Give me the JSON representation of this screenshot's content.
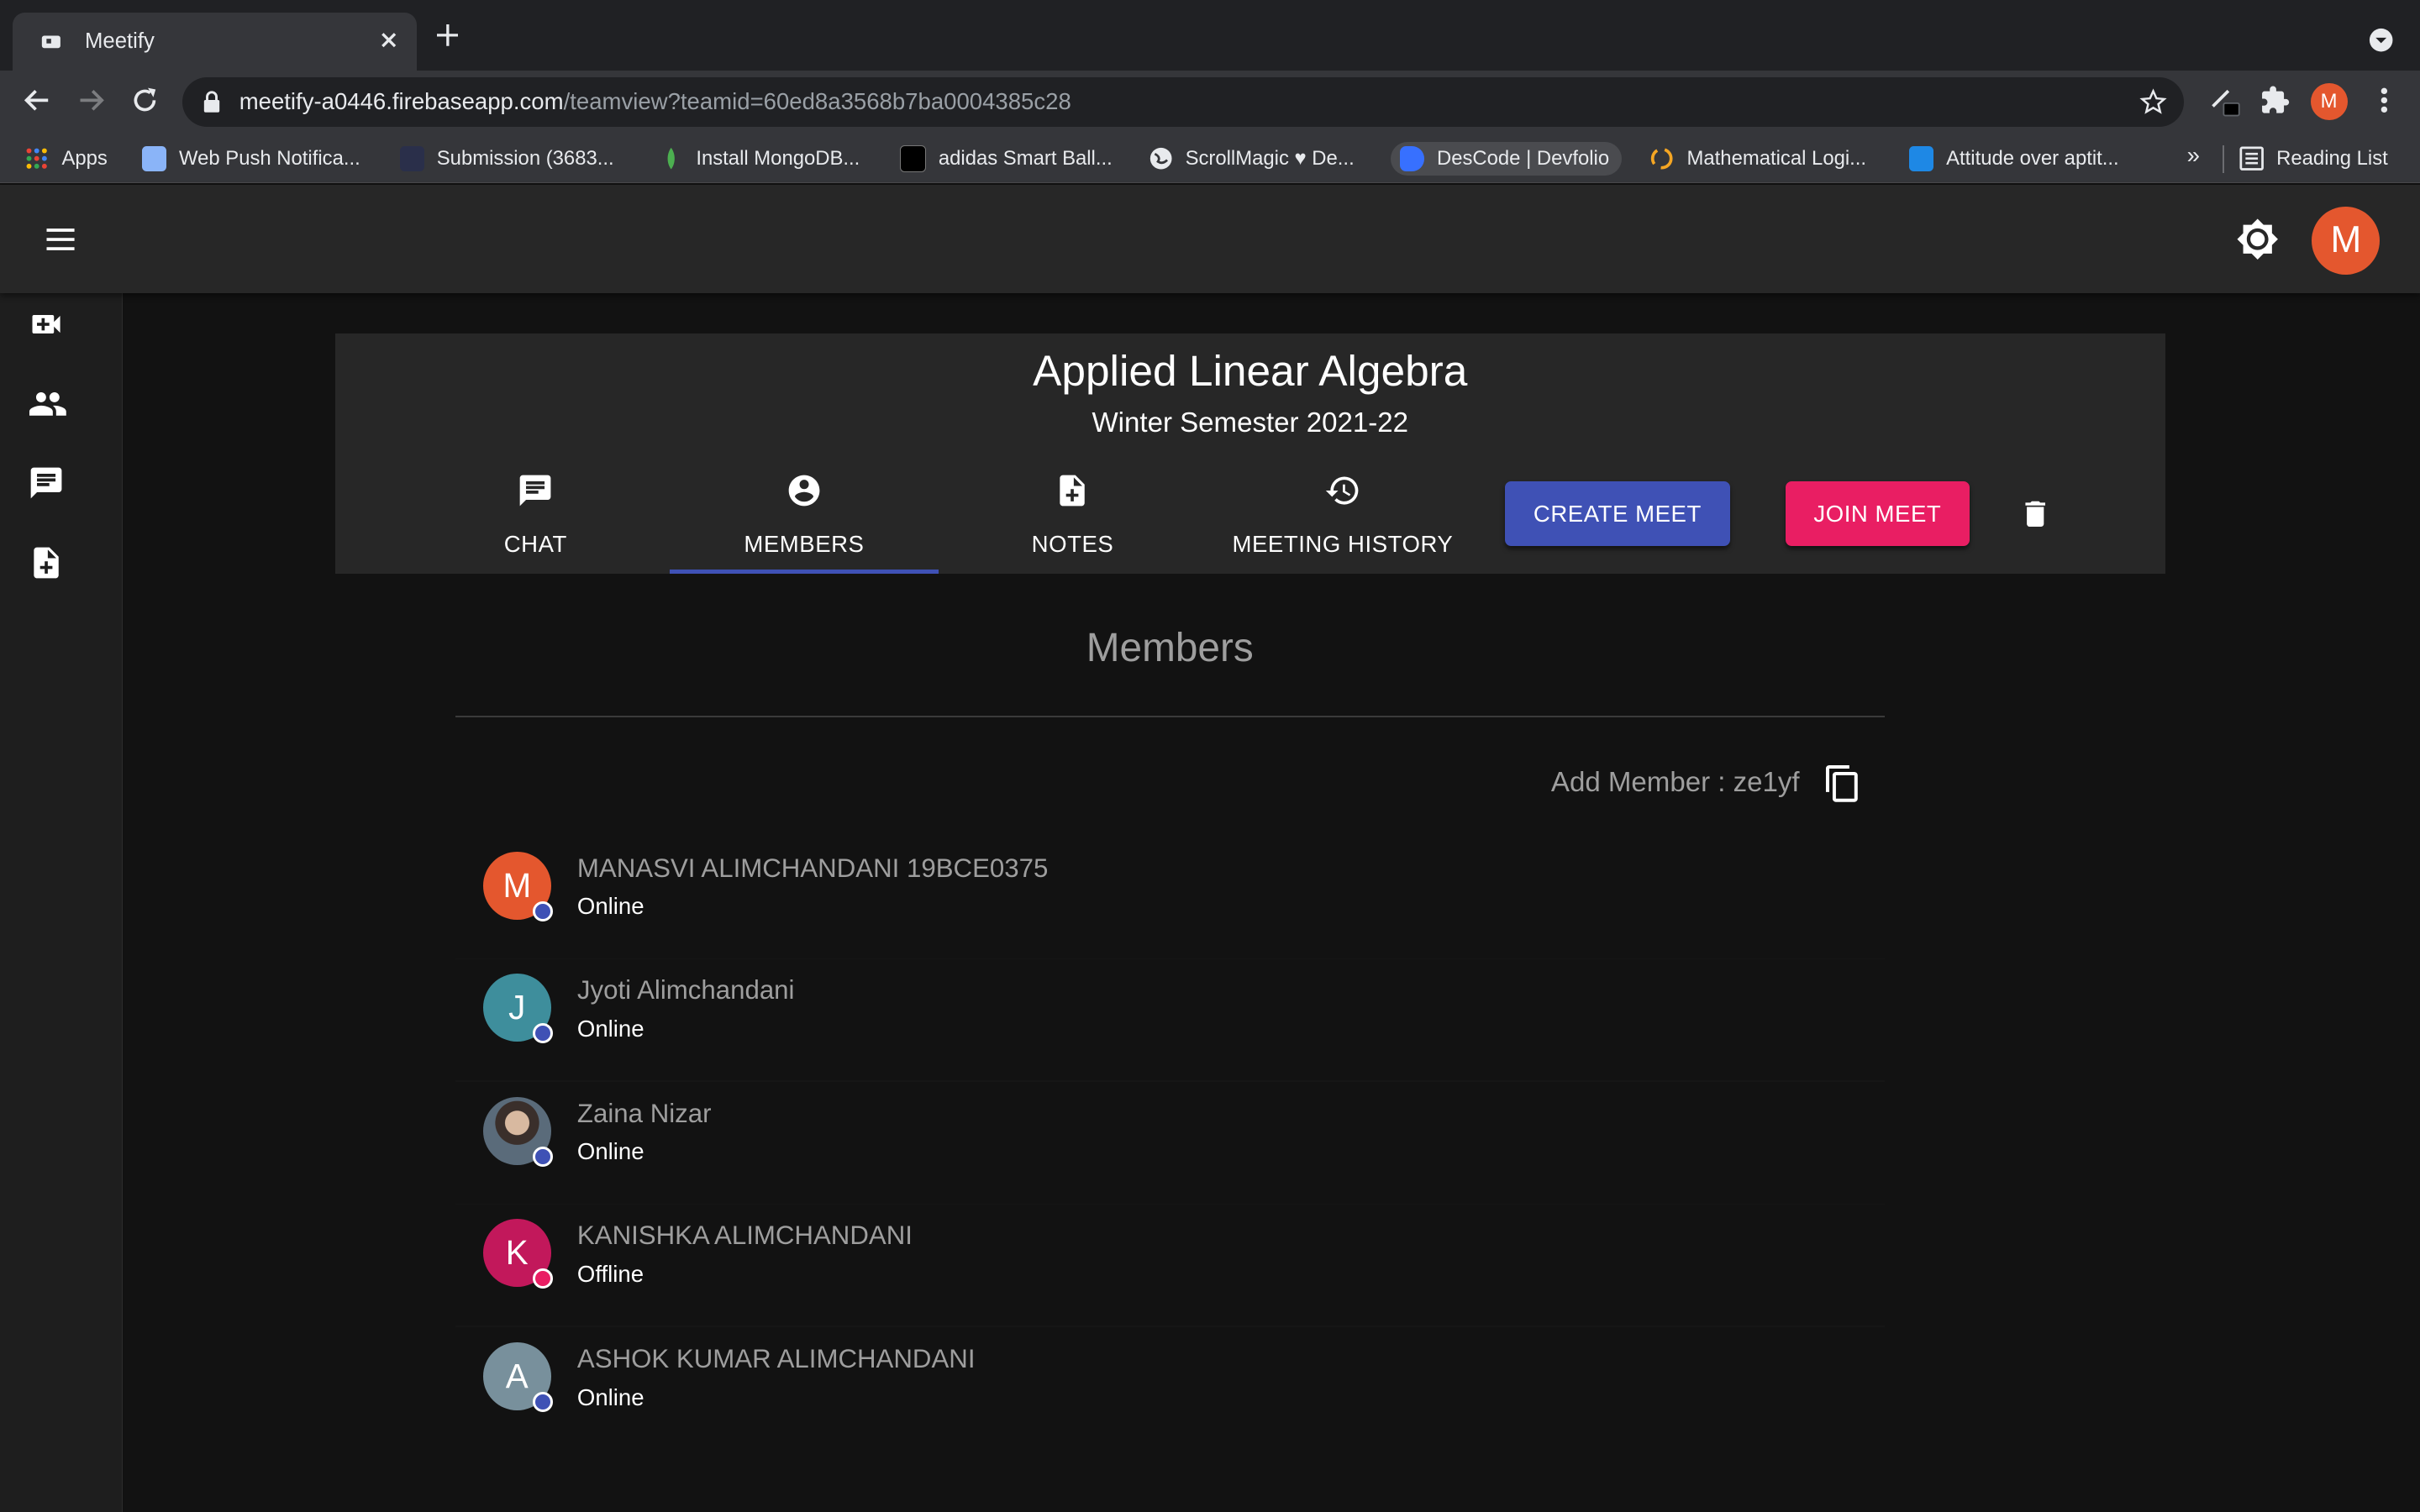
{
  "browser": {
    "tab_title": "Meetify",
    "url_host": "meetify-a0446.firebaseapp.com",
    "url_path": "/teamview?teamid=60ed8a3568b7ba0004385c28",
    "profile_initial": "M",
    "bookmarks": [
      {
        "label": "Apps",
        "color": "#ea4335"
      },
      {
        "label": "Web Push Notifica...",
        "color": "#8ab4f8"
      },
      {
        "label": "Submission (3683...",
        "color": "#2a2f4a"
      },
      {
        "label": "Install MongoDB...",
        "color": "#4caf50"
      },
      {
        "label": "adidas Smart Ball...",
        "color": "#ffffff"
      },
      {
        "label": "ScrollMagic ♥ De...",
        "color": "#e8eaed"
      },
      {
        "label": "DesCode | Devfolio",
        "color": "#3770ff"
      },
      {
        "label": "Mathematical Logi...",
        "color": "#f5a623"
      },
      {
        "label": "Attitude over aptit...",
        "color": "#1e88e5"
      }
    ],
    "bookmarks_more": "»",
    "reading_list": "Reading List"
  },
  "app": {
    "avatar_initial": "M",
    "course_title": "Applied Linear Algebra",
    "course_subtitle": "Winter Semester 2021-22",
    "tabs": [
      {
        "label": "CHAT",
        "icon": "chat-icon"
      },
      {
        "label": "MEMBERS",
        "icon": "account-circle-icon",
        "active": true
      },
      {
        "label": "NOTES",
        "icon": "note-add-icon"
      },
      {
        "label": "MEETING HISTORY",
        "icon": "history-icon"
      }
    ],
    "create_meet_label": "CREATE MEET",
    "join_meet_label": "JOIN MEET",
    "accent_primary": "#3f51b5",
    "accent_secondary": "#e91e63"
  },
  "members": {
    "heading": "Members",
    "add_member_label": "Add Member : ze1yf",
    "list": [
      {
        "initial": "M",
        "name": "MANASVI ALIMCHANDANI 19BCE0375",
        "status": "Online",
        "avatar_color": "#e4572e",
        "dot_color": "#3f51b5"
      },
      {
        "initial": "J",
        "name": "Jyoti Alimchandani",
        "status": "Online",
        "avatar_color": "#3e8e9c",
        "dot_color": "#3f51b5"
      },
      {
        "initial": "",
        "name": "Zaina Nizar",
        "status": "Online",
        "avatar_color": "#8d7b6e",
        "dot_color": "#3f51b5"
      },
      {
        "initial": "K",
        "name": "KANISHKA ALIMCHANDANI",
        "status": "Offline",
        "avatar_color": "#c2185b",
        "dot_color": "#e91e63"
      },
      {
        "initial": "A",
        "name": "ASHOK KUMAR ALIMCHANDANI",
        "status": "Online",
        "avatar_color": "#78909c",
        "dot_color": "#3f51b5"
      }
    ]
  }
}
